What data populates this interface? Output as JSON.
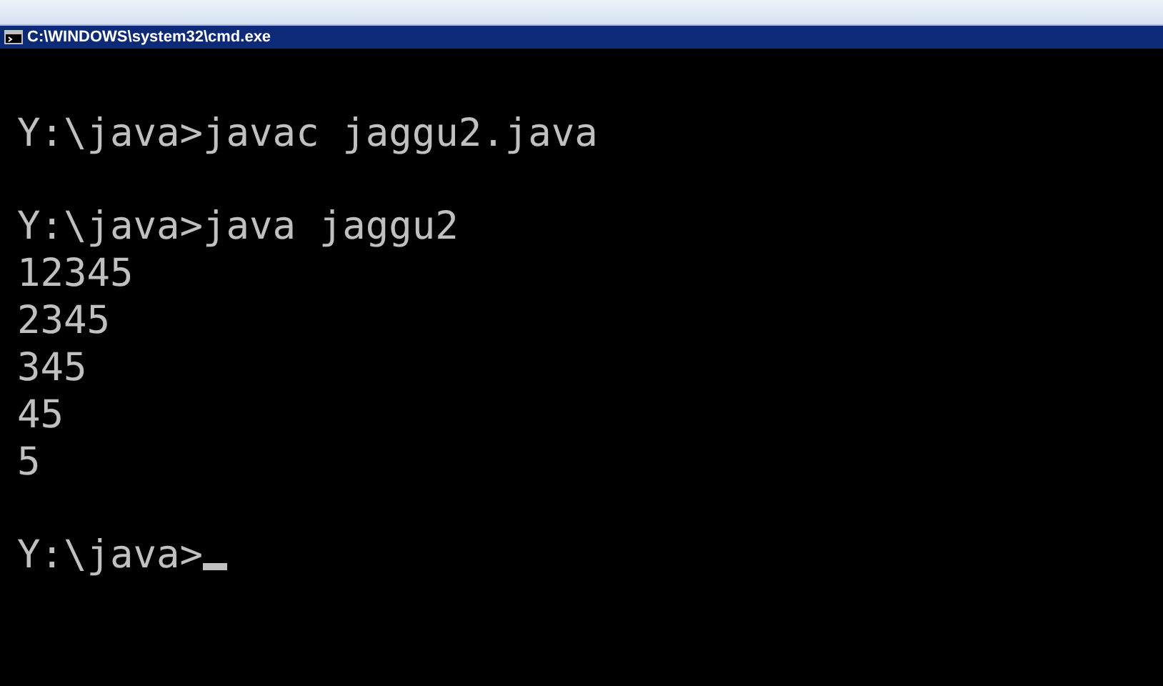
{
  "window": {
    "title": "C:\\WINDOWS\\system32\\cmd.exe"
  },
  "console": {
    "blocks": [
      [
        "Y:\\java>javac jaggu2.java"
      ],
      [
        "Y:\\java>java jaggu2",
        "12345",
        "2345",
        "345",
        "45",
        "5"
      ]
    ],
    "prompt": {
      "text": "Y:\\java>",
      "cursor": true
    }
  }
}
